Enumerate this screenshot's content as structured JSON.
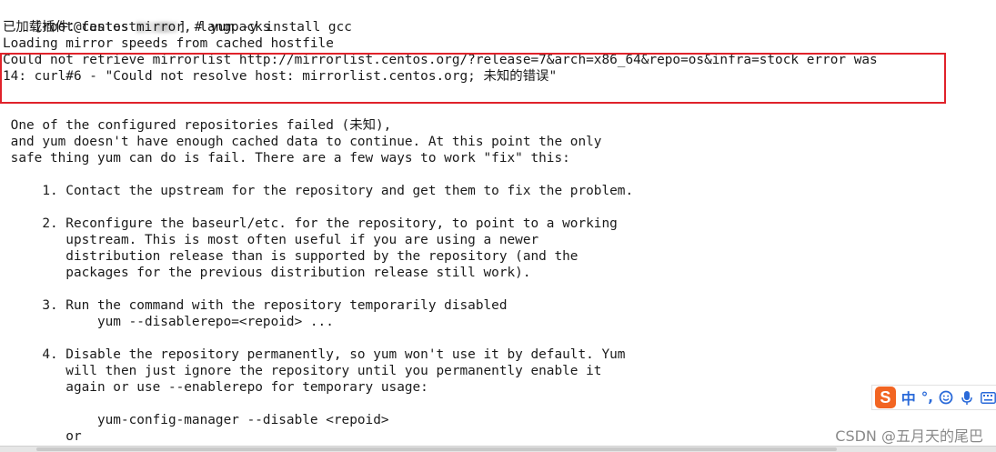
{
  "prompt": {
    "prefix": "[root@centos ",
    "suffix": "] # yum -y install gcc"
  },
  "lines": [
    "已加载插件：fastestmirror, langpacks",
    "Loading mirror speeds from cached hostfile",
    "Could not retrieve mirrorlist http://mirrorlist.centos.org/?release=7&arch=x86_64&repo=os&infra=stock error was",
    "14: curl#6 - \"Could not resolve host: mirrorlist.centos.org; 未知的错误\"",
    " One of the configured repositories failed (未知),",
    " and yum doesn't have enough cached data to continue. At this point the only",
    " safe thing yum can do is fail. There are a few ways to work \"fix\" this:",
    "     1. Contact the upstream for the repository and get them to fix the problem.",
    "     2. Reconfigure the baseurl/etc. for the repository, to point to a working",
    "        upstream. This is most often useful if you are using a newer",
    "        distribution release than is supported by the repository (and the",
    "        packages for the previous distribution release still work).",
    "     3. Run the command with the repository temporarily disabled",
    "            yum --disablerepo=<repoid> ...",
    "     4. Disable the repository permanently, so yum won't use it by default. Yum",
    "        will then just ignore the repository until you permanently enable it",
    "        again or use --enablerepo for temporary usage:",
    "            yum-config-manager --disable <repoid>",
    "        or"
  ],
  "ime": {
    "logo": "S",
    "mode": "中",
    "punct": "°,",
    "icons": [
      "emoji-icon",
      "microphone-icon",
      "keyboard-icon"
    ]
  },
  "watermark": "CSDN @五月天的尾巴",
  "colors": {
    "highlight_border": "#e0222a",
    "ime_accent": "#f26522",
    "ime_text": "#2a6ad9"
  }
}
